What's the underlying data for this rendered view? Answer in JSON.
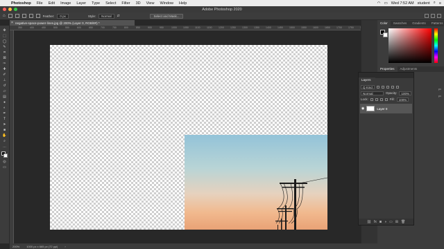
{
  "menubar": {
    "apple": "",
    "items": [
      "Photoshop",
      "File",
      "Edit",
      "Image",
      "Layer",
      "Type",
      "Select",
      "Filter",
      "3D",
      "View",
      "Window",
      "Help"
    ],
    "clock": "Wed 7:52 AM",
    "user": "student"
  },
  "window": {
    "title": "Adobe Photoshop 2020"
  },
  "options_bar": {
    "feather_label": "Feather:",
    "feather_value": "0 px",
    "style_label": "Style:",
    "style_value": "Normal",
    "select_mask_label": "Select and Mask..."
  },
  "document_tab": {
    "close": "×",
    "label": "negative-space-power-lines.jpg @ 200% (Layer 0, RGB/8#) *"
  },
  "ruler_ticks": [
    "350",
    "400",
    "450",
    "500",
    "550",
    "600",
    "650",
    "700",
    "750",
    "800",
    "850",
    "900",
    "950",
    "1000",
    "1050",
    "1100",
    "1150",
    "1200",
    "1250",
    "1300",
    "1350",
    "1400",
    "1450",
    "1500",
    "1550",
    "1600",
    "1650",
    "1700",
    "1750",
    "1800"
  ],
  "statusbar": {
    "zoom": "200%",
    "doc_info": "1000 px x 665 px (72 ppi)"
  },
  "color_panel": {
    "tabs": [
      "Color",
      "Swatches",
      "Gradients",
      "Patterns"
    ],
    "active_tab": "Color"
  },
  "properties_panel": {
    "tabs": [
      "Properties",
      "Adjustments"
    ],
    "rows": [
      "px",
      "px"
    ]
  },
  "layers_panel": {
    "tab": "Layers",
    "kind_filter": "Q Kind",
    "blend_mode": "Normal",
    "opacity_label": "Opacity:",
    "opacity_value": "100%",
    "lock_label": "Lock:",
    "fill_label": "Fill:",
    "fill_value": "100%",
    "layers": [
      {
        "name": "Layer 0",
        "visible": true
      }
    ]
  },
  "colors": {
    "accent": "#e05a4a",
    "panel_bg": "#3c3c3c",
    "workspace_bg": "#282828"
  }
}
